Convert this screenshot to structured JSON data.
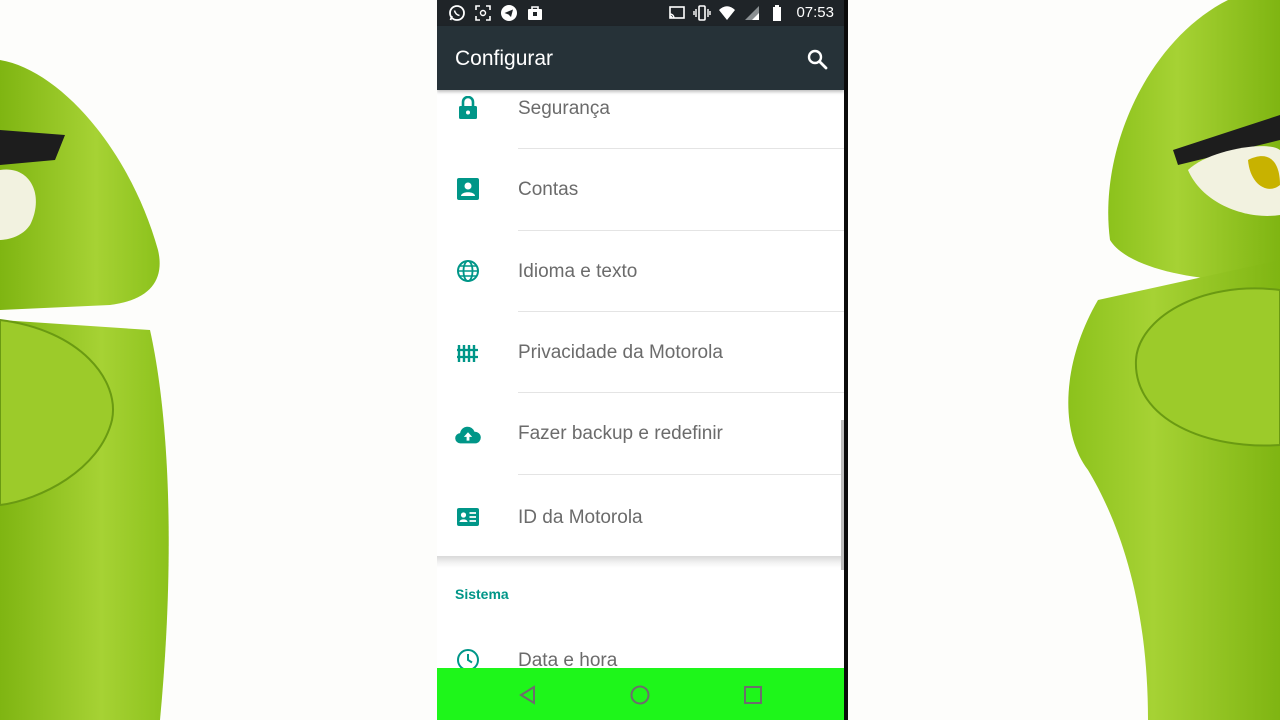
{
  "statusbar": {
    "notification_icons": [
      "whatsapp-icon",
      "screenshot-icon",
      "telegram-icon",
      "bag-icon"
    ],
    "system_icons": [
      "cast-icon",
      "vibrate-icon",
      "wifi-icon",
      "signal-icon",
      "battery-icon"
    ],
    "time": "07:53"
  },
  "appbar": {
    "title": "Configurar",
    "search_icon": "search-icon"
  },
  "settings": {
    "items": [
      {
        "label": "Segurança",
        "icon": "lock-icon"
      },
      {
        "label": "Contas",
        "icon": "account-icon"
      },
      {
        "label": "Idioma e texto",
        "icon": "globe-icon"
      },
      {
        "label": "Privacidade da Motorola",
        "icon": "fence-icon"
      },
      {
        "label": "Fazer backup e redefinir",
        "icon": "cloud-upload-icon"
      },
      {
        "label": "ID da Motorola",
        "icon": "id-card-icon"
      }
    ],
    "section_title": "Sistema",
    "system_items": [
      {
        "label": "Data e hora",
        "icon": "clock-icon"
      }
    ]
  },
  "navbar": {
    "buttons": [
      "back-icon",
      "home-icon",
      "recents-icon"
    ]
  },
  "colors": {
    "accent": "#009688",
    "appbar": "#263238",
    "statusbar": "#1f2428",
    "navbar": "#1ef61a",
    "label": "#6b6b6b"
  }
}
